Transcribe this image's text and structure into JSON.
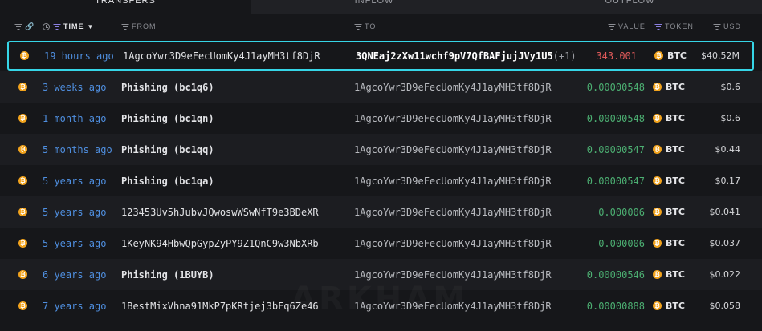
{
  "tabs": {
    "transfers": "TRANSFERS",
    "inflow": "INFLOW",
    "outflow": "OUTFLOW"
  },
  "header": {
    "time": "TIME",
    "from": "FROM",
    "to": "TO",
    "value": "VALUE",
    "token": "TOKEN",
    "usd": "USD"
  },
  "watermark": "ARKHAM",
  "colors": {
    "selected_border": "#36d6e7",
    "time_link": "#4f8fe0",
    "value_in": "#4caf72",
    "value_out": "#e05a5a",
    "btc": "#f2a31c"
  },
  "rows": [
    {
      "time": "19 hours ago",
      "from": "1AgcoYwr3D9eFecUomKy4J1ayMH3tf8DjR",
      "to": "3QNEaj2zXw11wchf9pV7QfBAFjujJVy1U5",
      "to_extra": "(+1)",
      "value": "343.001",
      "token": "BTC",
      "usd": "$40.52M"
    },
    {
      "time": "3 weeks ago",
      "from": "Phishing (bc1q6)",
      "to": "1AgcoYwr3D9eFecUomKy4J1ayMH3tf8DjR",
      "value": "0.00000548",
      "token": "BTC",
      "usd": "$0.6"
    },
    {
      "time": "1 month ago",
      "from": "Phishing (bc1qn)",
      "to": "1AgcoYwr3D9eFecUomKy4J1ayMH3tf8DjR",
      "value": "0.00000548",
      "token": "BTC",
      "usd": "$0.6"
    },
    {
      "time": "5 months ago",
      "from": "Phishing (bc1qq)",
      "to": "1AgcoYwr3D9eFecUomKy4J1ayMH3tf8DjR",
      "value": "0.00000547",
      "token": "BTC",
      "usd": "$0.44"
    },
    {
      "time": "5 years ago",
      "from": "Phishing (bc1qa)",
      "to": "1AgcoYwr3D9eFecUomKy4J1ayMH3tf8DjR",
      "value": "0.00000547",
      "token": "BTC",
      "usd": "$0.17"
    },
    {
      "time": "5 years ago",
      "from": "123453Uv5hJubvJQwoswWSwNfT9e3BDeXR",
      "to": "1AgcoYwr3D9eFecUomKy4J1ayMH3tf8DjR",
      "value": "0.000006",
      "token": "BTC",
      "usd": "$0.041"
    },
    {
      "time": "5 years ago",
      "from": "1KeyNK94HbwQpGypZyPY9Z1QnC9w3NbXRb",
      "to": "1AgcoYwr3D9eFecUomKy4J1ayMH3tf8DjR",
      "value": "0.000006",
      "token": "BTC",
      "usd": "$0.037"
    },
    {
      "time": "6 years ago",
      "from": "Phishing (1BUYB)",
      "to": "1AgcoYwr3D9eFecUomKy4J1ayMH3tf8DjR",
      "value": "0.00000546",
      "token": "BTC",
      "usd": "$0.022"
    },
    {
      "time": "7 years ago",
      "from": "1BestMixVhna91MkP7pKRtjej3bFq6Ze46",
      "to": "1AgcoYwr3D9eFecUomKy4J1ayMH3tf8DjR",
      "value": "0.00000888",
      "token": "BTC",
      "usd": "$0.058"
    }
  ]
}
